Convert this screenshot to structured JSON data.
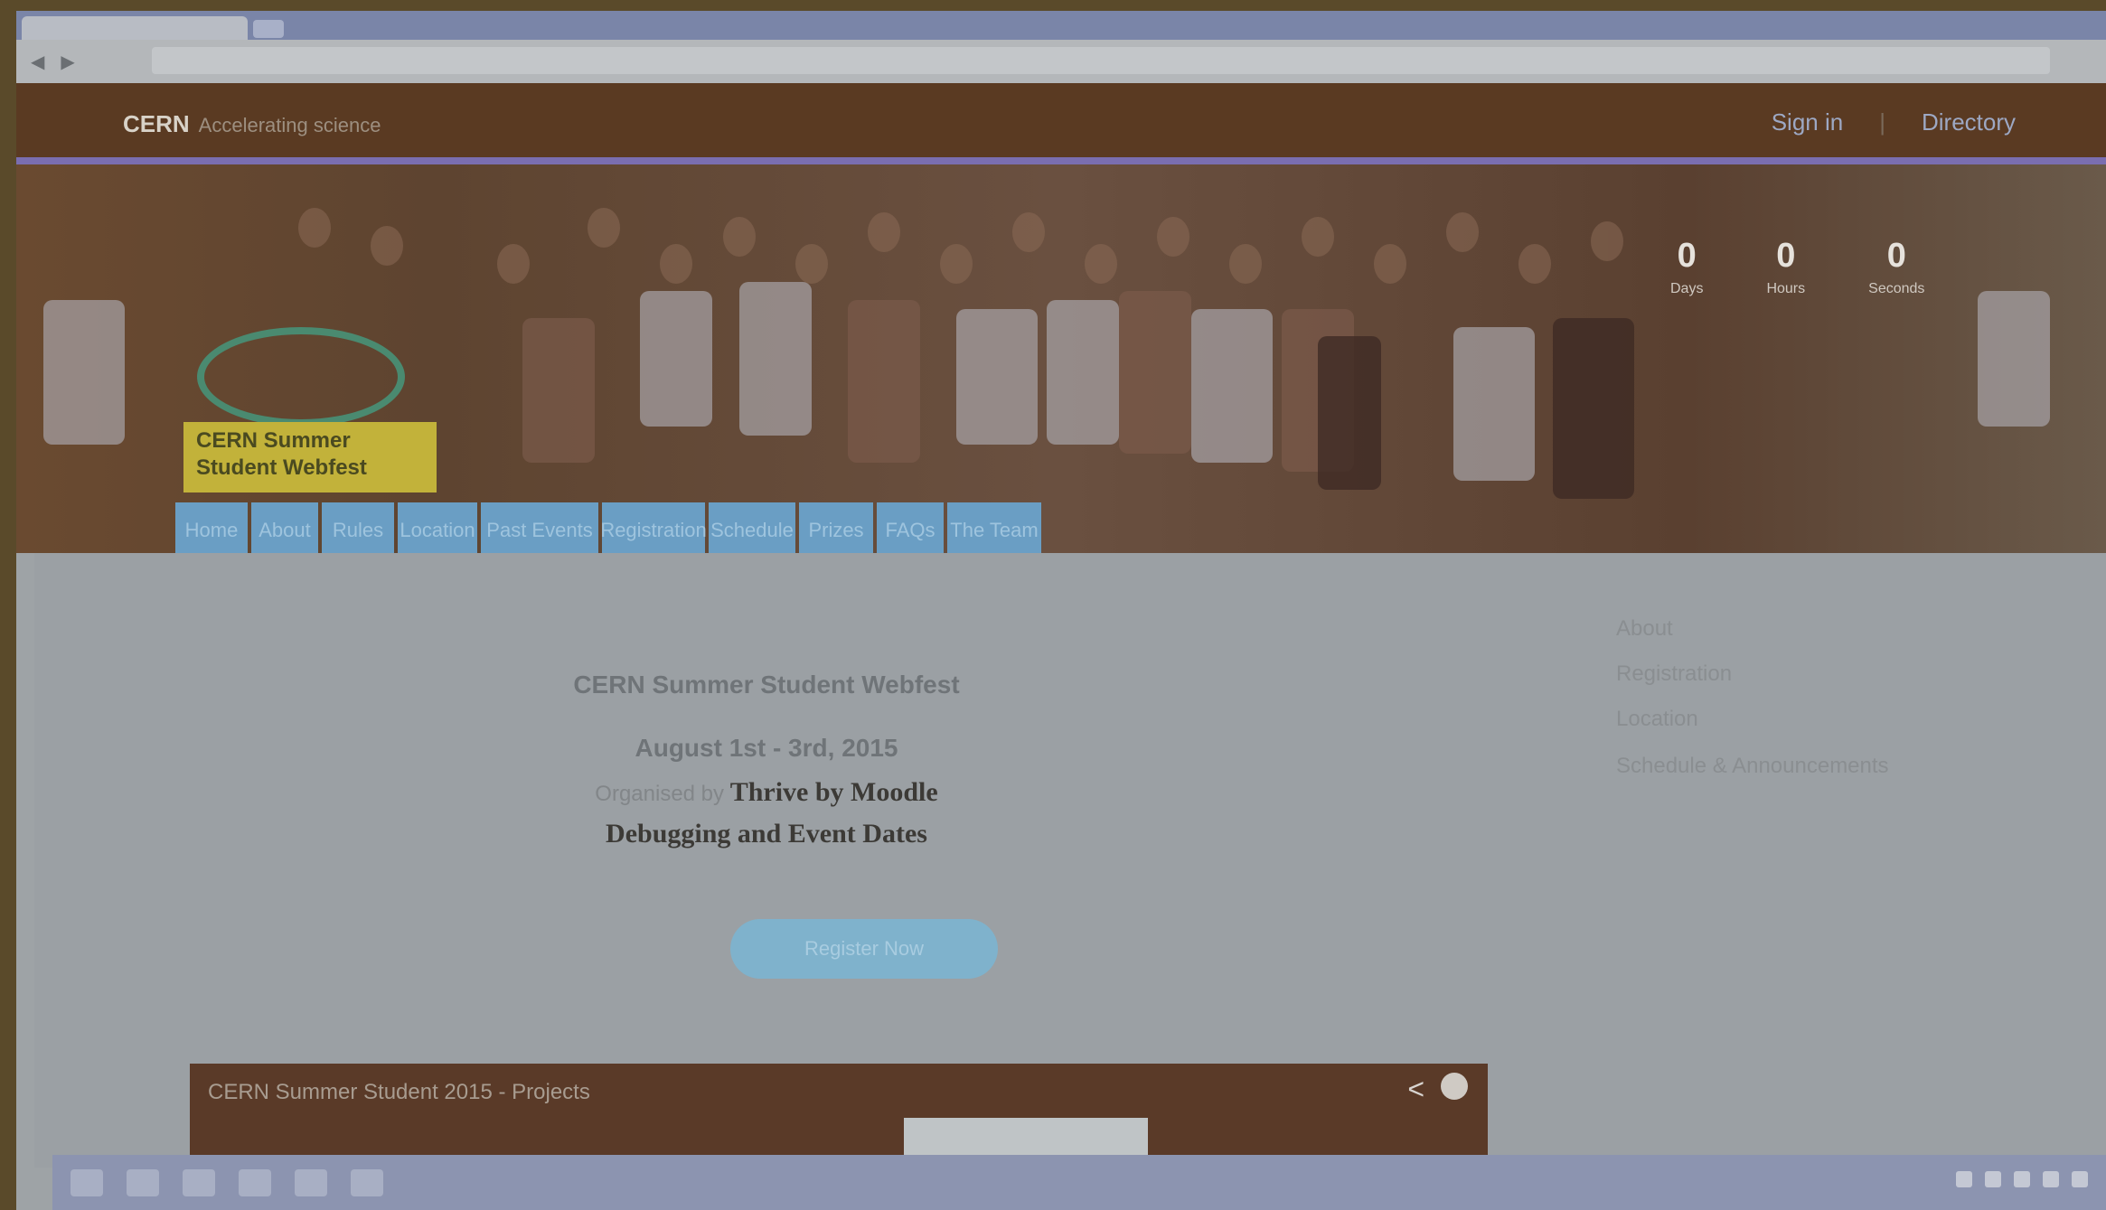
{
  "site": {
    "brand": "CERN",
    "brand_sub": "Accelerating science",
    "sign_in": "Sign in",
    "directory": "Directory"
  },
  "hero": {
    "logo_text_line1": "CERN Summer",
    "logo_text_line2": "Student Webfest",
    "counters": [
      {
        "num": "0",
        "label": "Days"
      },
      {
        "num": "0",
        "label": "Hours"
      },
      {
        "num": "0",
        "label": "Seconds"
      }
    ]
  },
  "nav": [
    {
      "label": "Home",
      "width": 110
    },
    {
      "label": "About",
      "width": 104
    },
    {
      "label": "Rules",
      "width": 106
    },
    {
      "label": "Location",
      "width": 118
    },
    {
      "label": "Past Events",
      "width": 168
    },
    {
      "label": "Registration",
      "width": 152
    },
    {
      "label": "Schedule",
      "width": 128
    },
    {
      "label": "Prizes",
      "width": 112
    },
    {
      "label": "FAQs",
      "width": 100
    },
    {
      "label": "The Team",
      "width": 138
    }
  ],
  "content": {
    "heading": "CERN Summer Student Webfest",
    "subheading": "August 1st - 3rd, 2015",
    "line1_pre": "Organised by",
    "line1_bold": "Thrive by Moodle",
    "line1_post": "",
    "line2_pre": "",
    "line2_bold": "Debugging and Event Dates",
    "line2_post": "",
    "line3": "",
    "cta": "Register Now"
  },
  "video": {
    "title": "CERN Summer Student 2015 - Projects"
  },
  "sidebar": {
    "links": [
      "About",
      "Registration",
      "Location",
      "Schedule & Announcements",
      "",
      "",
      ""
    ]
  },
  "colors": {
    "topbar": "#5a3a22",
    "accent_line": "#7a6eb0",
    "nav_bg": "#6a9ec4",
    "cta_bg": "#7fb2cc"
  }
}
